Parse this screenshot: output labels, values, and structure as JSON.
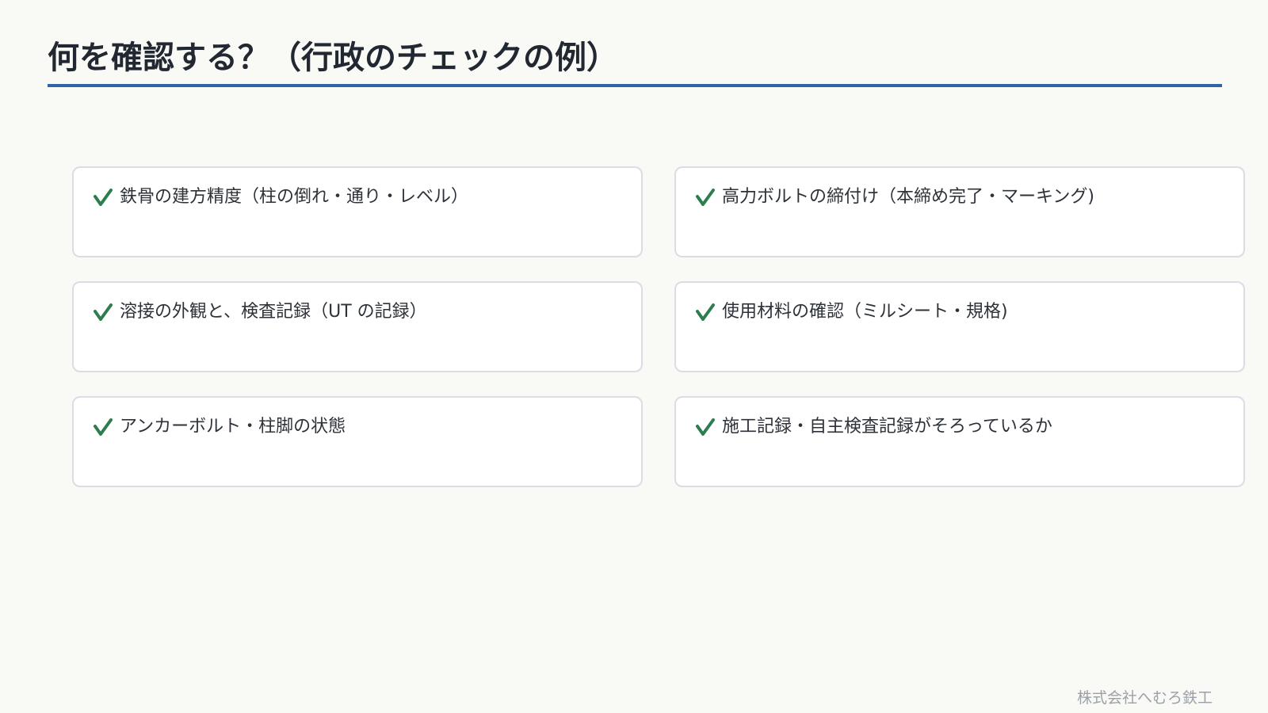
{
  "slide": {
    "title": "何を確認する？（行政のチェックの例）",
    "accent_color": "#2f64a6",
    "check_color": "#2e7d4f",
    "check_icon": "checkmark-icon",
    "items": [
      {
        "text": "鉄骨の建方精度（柱の倒れ・通り・レベル）"
      },
      {
        "text": "高力ボルトの締付け（本締め完了・マーキング)"
      },
      {
        "text": "溶接の外観と、検査記録（UT の記録）"
      },
      {
        "text": "使用材料の確認（ミルシート・規格)"
      },
      {
        "text": "アンカーボルト・柱脚の状態"
      },
      {
        "text": "施工記録・自主検査記録がそろっているか"
      }
    ],
    "footer": "株式会社へむろ鉄工"
  }
}
